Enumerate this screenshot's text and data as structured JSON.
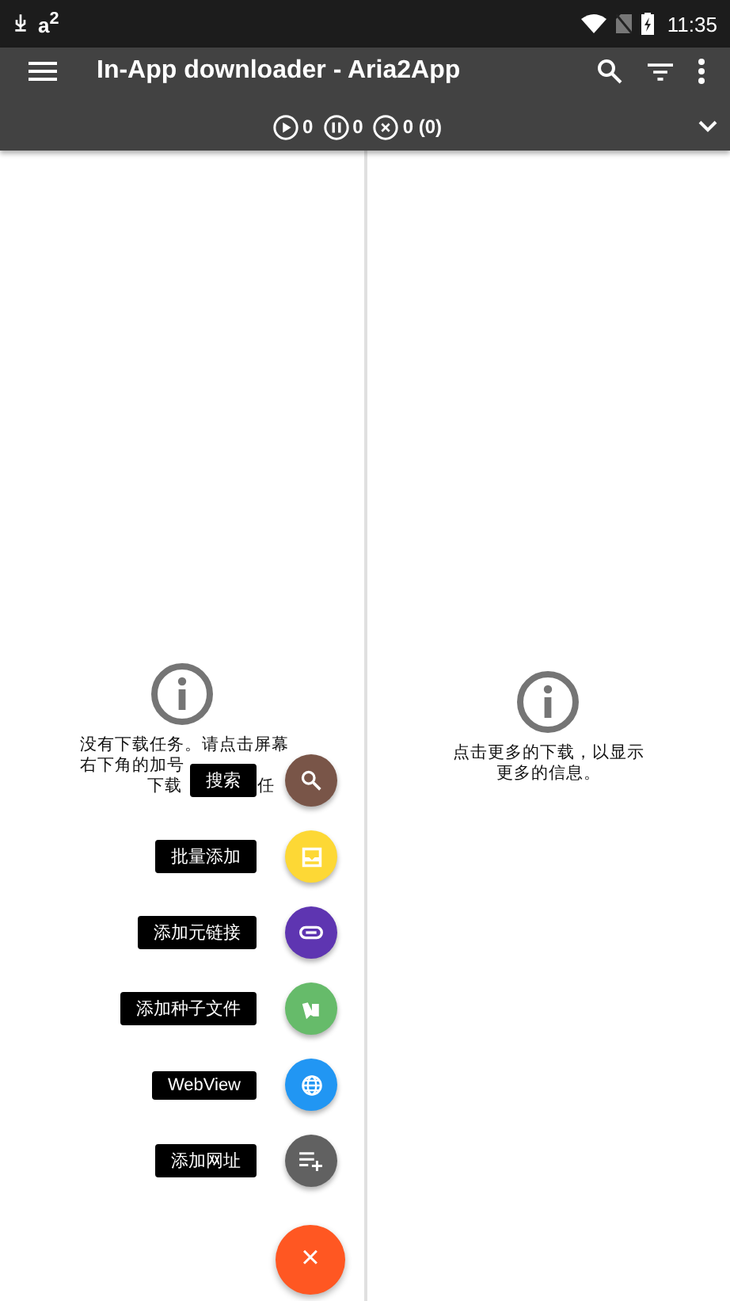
{
  "status_bar": {
    "notification_text": "a$^{2}$",
    "time": "11:35"
  },
  "toolbar": {
    "title": "In-App downloader - Aria2App"
  },
  "summary": {
    "active": "0",
    "paused": "0",
    "stopped": "0 (0)"
  },
  "panels": [
    {
      "message_parts": [
        "没有下载任务。请点击屏幕",
        "右下角的加号",
        "下载",
        "任"
      ]
    },
    {
      "message": "点击更多的下载，以显示更多的信息。"
    }
  ],
  "fab_menu": [
    {
      "label": "搜索",
      "kind": "search",
      "color": "#795548"
    },
    {
      "label": "批量添加",
      "kind": "batch",
      "color": "#fdd835"
    },
    {
      "label": "添加元链接",
      "kind": "metalink",
      "color": "#5e35b1"
    },
    {
      "label": "添加种子文件",
      "kind": "torrent",
      "color": "#66bb6a"
    },
    {
      "label": "WebView",
      "kind": "webview",
      "color": "#2196f3"
    },
    {
      "label": "添加网址",
      "kind": "url",
      "color": "#616161"
    }
  ],
  "main_fab": {
    "symbol": "×"
  }
}
